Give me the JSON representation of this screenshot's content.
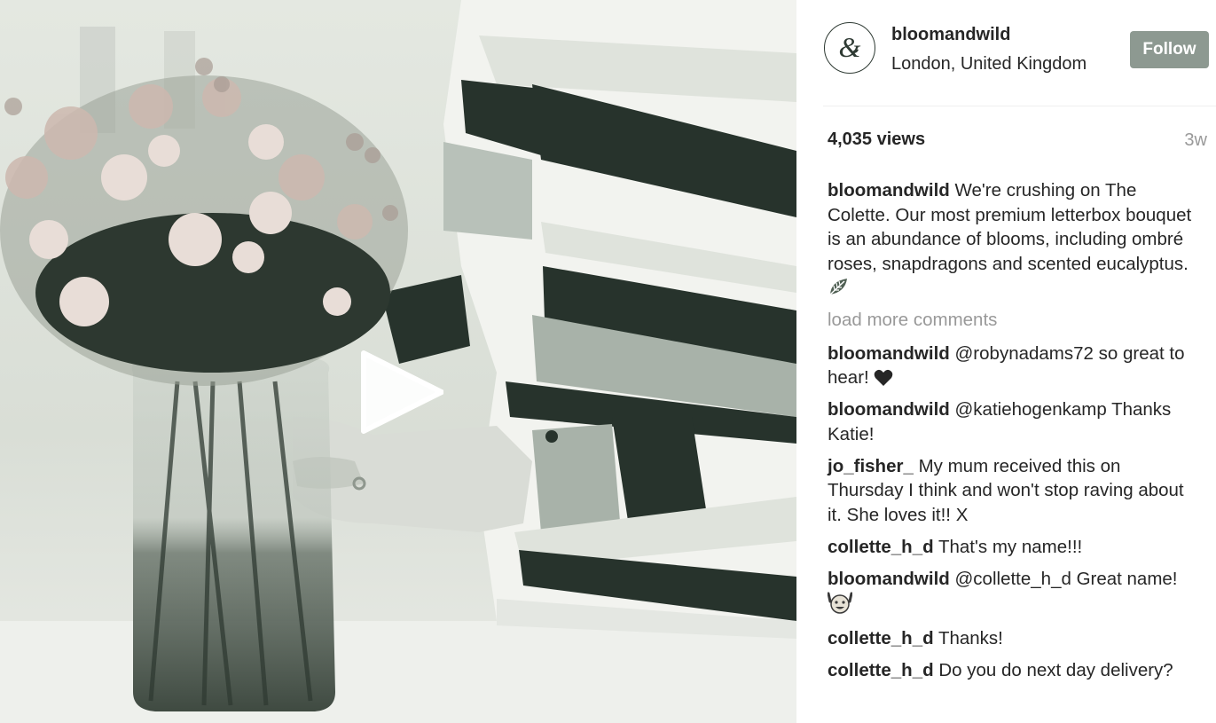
{
  "media": {
    "type": "video",
    "play_icon": "play-icon"
  },
  "header": {
    "username": "bloomandwild",
    "location": "London, United Kingdom",
    "follow_label": "Follow",
    "avatar_icon": "ampersand-logo-icon"
  },
  "stats": {
    "views": "4,035 views",
    "time_ago": "3w"
  },
  "caption": {
    "user": "bloomandwild",
    "text": "We're crushing on The Colette. Our most premium letterbox bouquet is an abundance of blooms, including ombré roses, snapdragons and scented eucalyptus.",
    "emoji": "leaf-icon"
  },
  "load_more_label": "load more comments",
  "comments": [
    {
      "user": "bloomandwild",
      "text": "@robynadams72 so great to hear!",
      "emoji": "heart-icon"
    },
    {
      "user": "bloomandwild",
      "text": "@katiehogenkamp Thanks Katie!"
    },
    {
      "user": "jo_fisher_",
      "text": "My mum received this on Thursday I think and won't stop raving about it. She loves it!! X"
    },
    {
      "user": "collette_h_d",
      "text": "That's my name!!!"
    },
    {
      "user": "bloomandwild",
      "text": "@collette_h_d Great name!",
      "emoji": "cheering-face-icon"
    },
    {
      "user": "collette_h_d",
      "text": "Thanks!"
    },
    {
      "user": "collette_h_d",
      "text": "Do you do next day delivery?"
    }
  ],
  "colors": {
    "follow_bg": "#8d9991",
    "text": "#262626",
    "muted": "#999999",
    "brand": "#2e3a33"
  }
}
